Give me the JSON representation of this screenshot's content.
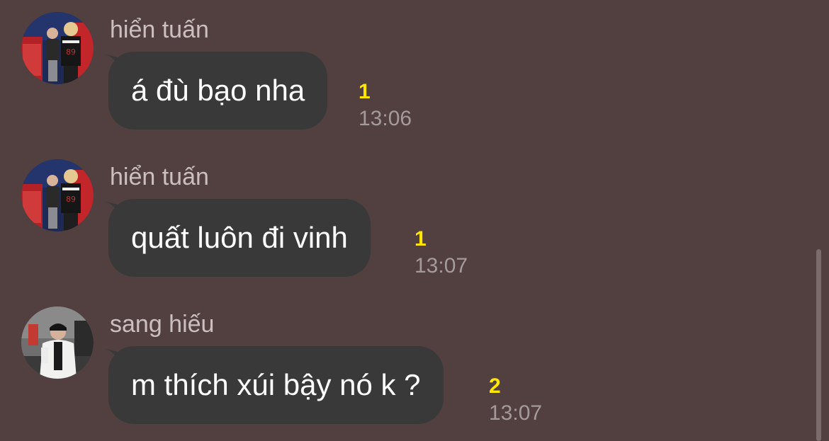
{
  "messages": [
    {
      "sender": "hiển tuấn",
      "text": "á đù bạo nha",
      "unread": "1",
      "time": "13:06",
      "avatar": "avatar-two-people"
    },
    {
      "sender": "hiển tuấn",
      "text": "quất luôn đi vinh",
      "unread": "1",
      "time": "13:07",
      "avatar": "avatar-two-people"
    },
    {
      "sender": "sang hiếu",
      "text": "m thích xúi bậy nó k ?",
      "unread": "2",
      "time": "13:07",
      "avatar": "avatar-person-jacket"
    }
  ],
  "colors": {
    "background": "#524041",
    "bubble": "#393939",
    "unread": "#ffe600",
    "time": "#a59a9a",
    "sender": "#cbbfbf"
  }
}
